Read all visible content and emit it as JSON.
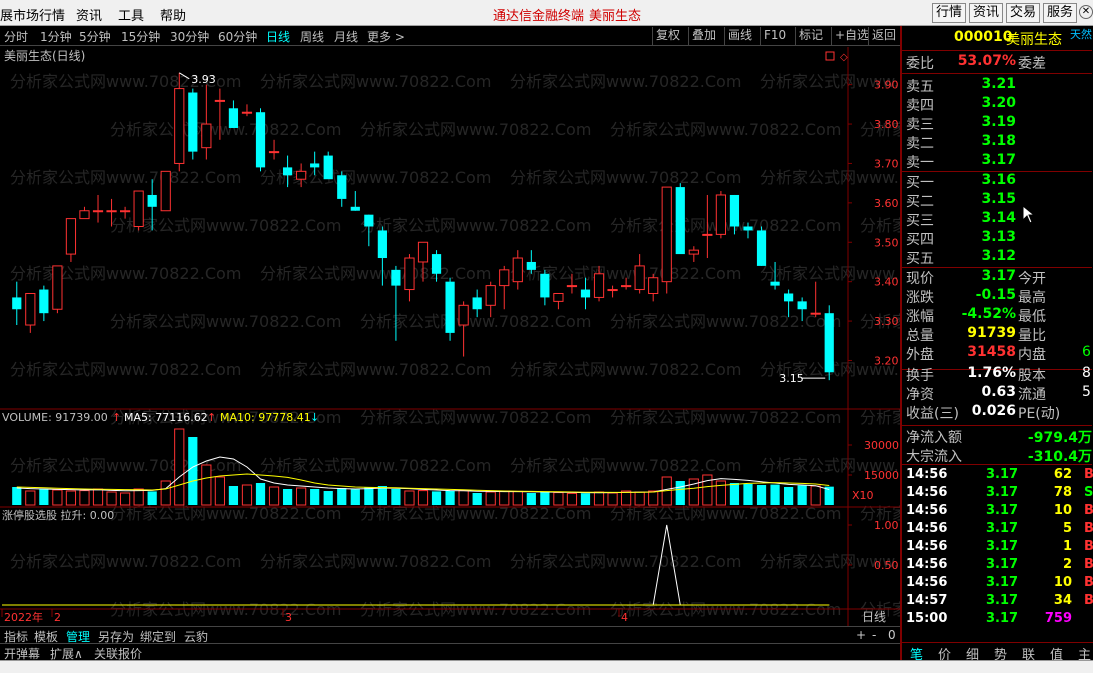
{
  "menubar": {
    "items": [
      "展市场行情",
      "资讯",
      "工具",
      "帮助"
    ],
    "center_title": "通达信金融终端",
    "center_stock": "美丽生态",
    "right_buttons": [
      "行情",
      "资讯",
      "交易",
      "服务"
    ]
  },
  "toolbar": {
    "periods": [
      "分时",
      "1分钟",
      "5分钟",
      "15分钟",
      "30分钟",
      "60分钟",
      "日线",
      "周线",
      "月线",
      "更多 >"
    ],
    "active_period": "日线",
    "buttons": [
      "复权",
      "叠加",
      "画线",
      "F10",
      "标记",
      "+自选",
      "返回"
    ]
  },
  "chart": {
    "title": "美丽生态(日线)",
    "high_label": "3.93",
    "low_label": "3.15",
    "volume_legend": {
      "volume": "VOLUME: 91739.00",
      "ma5": "MA5: 77116.62",
      "ma10": "MA10: 97778.41"
    },
    "indicator_legend": "涨停股选股  拉升: 0.00",
    "x_labels": [
      "2022年",
      "2",
      "3",
      "4"
    ],
    "period_label": "日线",
    "zoom_buttons": [
      "+",
      "-",
      "0"
    ],
    "multiplier": "X10",
    "watermark": "分析家公式网www.70822.Com",
    "colors": {
      "up": "#ff3232",
      "down": "#00ffff",
      "ma5": "#ffffff",
      "ma10": "#ffff00",
      "axis": "#800000"
    }
  },
  "chart_data": [
    {
      "type": "candlestick",
      "title": "美丽生态(日线)",
      "ylim": [
        3.12,
        3.96
      ],
      "yticks": [
        3.2,
        3.3,
        3.4,
        3.5,
        3.6,
        3.7,
        3.8,
        3.9
      ],
      "ohlc": [
        [
          3.36,
          3.4,
          3.29,
          3.33
        ],
        [
          3.29,
          3.37,
          3.27,
          3.37
        ],
        [
          3.38,
          3.39,
          3.3,
          3.32
        ],
        [
          3.33,
          3.44,
          3.32,
          3.44
        ],
        [
          3.47,
          3.56,
          3.45,
          3.56
        ],
        [
          3.56,
          3.59,
          3.57,
          3.58
        ],
        [
          3.58,
          3.62,
          3.55,
          3.58
        ],
        [
          3.58,
          3.61,
          3.54,
          3.58
        ],
        [
          3.58,
          3.59,
          3.56,
          3.58
        ],
        [
          3.54,
          3.63,
          3.53,
          3.63
        ],
        [
          3.62,
          3.66,
          3.53,
          3.59
        ],
        [
          3.58,
          3.68,
          3.58,
          3.68
        ],
        [
          3.7,
          3.93,
          3.68,
          3.89
        ],
        [
          3.88,
          3.89,
          3.71,
          3.73
        ],
        [
          3.74,
          3.9,
          3.71,
          3.8
        ],
        [
          3.86,
          3.89,
          3.76,
          3.86
        ],
        [
          3.84,
          3.86,
          3.79,
          3.79
        ],
        [
          3.83,
          3.85,
          3.82,
          3.83
        ],
        [
          3.83,
          3.84,
          3.68,
          3.69
        ],
        [
          3.73,
          3.76,
          3.71,
          3.73
        ],
        [
          3.69,
          3.72,
          3.64,
          3.67
        ],
        [
          3.66,
          3.7,
          3.64,
          3.68
        ],
        [
          3.7,
          3.73,
          3.67,
          3.69
        ],
        [
          3.72,
          3.73,
          3.67,
          3.66
        ],
        [
          3.67,
          3.68,
          3.59,
          3.61
        ],
        [
          3.59,
          3.63,
          3.58,
          3.58
        ],
        [
          3.57,
          3.57,
          3.49,
          3.54
        ],
        [
          3.53,
          3.54,
          3.39,
          3.46
        ],
        [
          3.43,
          3.44,
          3.25,
          3.39
        ],
        [
          3.38,
          3.47,
          3.35,
          3.46
        ],
        [
          3.45,
          3.49,
          3.4,
          3.5
        ],
        [
          3.47,
          3.48,
          3.4,
          3.42
        ],
        [
          3.4,
          3.41,
          3.25,
          3.27
        ],
        [
          3.29,
          3.35,
          3.21,
          3.34
        ],
        [
          3.36,
          3.38,
          3.31,
          3.33
        ],
        [
          3.34,
          3.4,
          3.31,
          3.39
        ],
        [
          3.39,
          3.44,
          3.33,
          3.43
        ],
        [
          3.4,
          3.48,
          3.38,
          3.46
        ],
        [
          3.45,
          3.48,
          3.42,
          3.43
        ],
        [
          3.42,
          3.43,
          3.34,
          3.36
        ],
        [
          3.35,
          3.37,
          3.33,
          3.37
        ],
        [
          3.39,
          3.42,
          3.37,
          3.39
        ],
        [
          3.38,
          3.41,
          3.33,
          3.36
        ],
        [
          3.36,
          3.44,
          3.35,
          3.42
        ],
        [
          3.38,
          3.39,
          3.36,
          3.38
        ],
        [
          3.39,
          3.41,
          3.38,
          3.39
        ],
        [
          3.38,
          3.47,
          3.37,
          3.44
        ],
        [
          3.37,
          3.42,
          3.35,
          3.41
        ],
        [
          3.4,
          3.63,
          3.37,
          3.64
        ],
        [
          3.64,
          3.65,
          3.48,
          3.47
        ],
        [
          3.47,
          3.49,
          3.45,
          3.48
        ],
        [
          3.52,
          3.62,
          3.46,
          3.52
        ],
        [
          3.52,
          3.63,
          3.51,
          3.62
        ],
        [
          3.62,
          3.62,
          3.52,
          3.54
        ],
        [
          3.54,
          3.55,
          3.51,
          3.53
        ],
        [
          3.53,
          3.54,
          3.44,
          3.44
        ],
        [
          3.4,
          3.45,
          3.38,
          3.39
        ],
        [
          3.37,
          3.38,
          3.31,
          3.35
        ],
        [
          3.35,
          3.36,
          3.3,
          3.33
        ],
        [
          3.32,
          3.4,
          3.31,
          3.32
        ],
        [
          3.32,
          3.34,
          3.15,
          3.17
        ]
      ],
      "price_labels": {
        "high": "3.93",
        "low": "3.15"
      }
    },
    {
      "type": "bar",
      "title": "VOLUME",
      "ylim": [
        0,
        40000
      ],
      "yticks": [
        15000,
        30000
      ],
      "unit_label": "X10",
      "values": [
        9000,
        7000,
        8000,
        7500,
        7000,
        7200,
        8000,
        6500,
        6000,
        8000,
        6800,
        12000,
        38000,
        34000,
        20000,
        14000,
        9500,
        10000,
        11000,
        9000,
        8000,
        8500,
        8000,
        7000,
        8500,
        7800,
        9000,
        9500,
        8000,
        7000,
        7200,
        6800,
        7000,
        7500,
        6000,
        6500,
        7000,
        6800,
        6000,
        6400,
        6200,
        5800,
        5900,
        6500,
        6000,
        7000,
        6500,
        7000,
        14000,
        12000,
        13000,
        15000,
        12000,
        11000,
        10500,
        10000,
        10200,
        9000,
        9800,
        9500,
        9174
      ],
      "ma5_values": [
        8500,
        8200,
        8000,
        7800,
        7700,
        7500,
        7600,
        7300,
        7100,
        7200,
        7300,
        8200,
        14000,
        19000,
        22000,
        24000,
        23000,
        19000,
        13000,
        11000,
        10000,
        9500,
        9000,
        8500,
        8200,
        8000,
        8200,
        8500,
        8400,
        8200,
        7800,
        7500,
        7200,
        7100,
        6900,
        6800,
        6700,
        6700,
        6600,
        6500,
        6400,
        6300,
        6200,
        6100,
        6200,
        6300,
        6400,
        6500,
        7800,
        9000,
        10500,
        12200,
        13200,
        12800,
        12300,
        11600,
        11000,
        10300,
        10000,
        9600,
        7712
      ],
      "ma10_values": [
        9000,
        8800,
        8600,
        8400,
        8200,
        8000,
        7900,
        7800,
        7700,
        7600,
        7500,
        8000,
        10000,
        12000,
        13500,
        14500,
        15000,
        15500,
        15000,
        14500,
        13800,
        12500,
        11000,
        10000,
        9500,
        9000,
        8800,
        8700,
        8600,
        8400,
        8200,
        8000,
        7800,
        7600,
        7400,
        7200,
        7000,
        6900,
        6800,
        6700,
        6600,
        6500,
        6400,
        6400,
        6300,
        6300,
        6400,
        6500,
        7200,
        7800,
        8400,
        9200,
        9800,
        10300,
        10800,
        11000,
        11200,
        11000,
        10800,
        10500,
        9778
      ]
    },
    {
      "type": "line",
      "title": "涨停股选股",
      "ylim": [
        0,
        1.1
      ],
      "yticks": [
        0.5,
        1.0
      ],
      "values": [
        0,
        0,
        0,
        0,
        0,
        0,
        0,
        0,
        0,
        0,
        0,
        0,
        0,
        0,
        0,
        0,
        0,
        0,
        0,
        0,
        0,
        0,
        0,
        0,
        0,
        0,
        0,
        0,
        0,
        0,
        0,
        0,
        0,
        0,
        0,
        0,
        0,
        0,
        0,
        0,
        0,
        0,
        0,
        0,
        0,
        0,
        0,
        0,
        1,
        0,
        0,
        0,
        0,
        0,
        0,
        0,
        0,
        0,
        0,
        0,
        0
      ]
    }
  ],
  "quote": {
    "code": "000010",
    "name": "美丽生态",
    "extra": "天然",
    "wei_bi_label": "委比",
    "wei_bi_value": "53.07%",
    "wei_cha_label": "委差",
    "asks": [
      {
        "label": "卖五",
        "price": "3.21"
      },
      {
        "label": "卖四",
        "price": "3.20"
      },
      {
        "label": "卖三",
        "price": "3.19"
      },
      {
        "label": "卖二",
        "price": "3.18"
      },
      {
        "label": "卖一",
        "price": "3.17"
      }
    ],
    "bids": [
      {
        "label": "买一",
        "price": "3.16"
      },
      {
        "label": "买二",
        "price": "3.15"
      },
      {
        "label": "买三",
        "price": "3.14"
      },
      {
        "label": "买四",
        "price": "3.13"
      },
      {
        "label": "买五",
        "price": "3.12"
      }
    ],
    "stats": [
      {
        "l1": "现价",
        "v1": "3.17",
        "c1": "#00ff00",
        "l2": "今开",
        "v2": ""
      },
      {
        "l1": "涨跌",
        "v1": "-0.15",
        "c1": "#00ff00",
        "l2": "最高",
        "v2": ""
      },
      {
        "l1": "涨幅",
        "v1": "-4.52%",
        "c1": "#00ff00",
        "l2": "最低",
        "v2": ""
      },
      {
        "l1": "总量",
        "v1": "91739",
        "c1": "#ffff00",
        "l2": "量比",
        "v2": ""
      },
      {
        "l1": "外盘",
        "v1": "31458",
        "c1": "#ff3232",
        "l2": "内盘",
        "v2": "6"
      }
    ],
    "stats2": [
      {
        "l1": "换手",
        "v1": "1.76%",
        "c1": "#ffffff",
        "l2": "股本",
        "v2": "8"
      },
      {
        "l1": "净资",
        "v1": "0.63",
        "c1": "#ffffff",
        "l2": "流通",
        "v2": "5"
      },
      {
        "l1": "收益(三)",
        "v1": "0.026",
        "c1": "#ffffff",
        "l2": "PE(动)",
        "v2": ""
      }
    ],
    "flows": [
      {
        "label": "净流入额",
        "value": "-979.4万"
      },
      {
        "label": "大宗流入",
        "value": "-310.4万"
      }
    ],
    "ticks": [
      {
        "time": "14:56",
        "price": "3.17",
        "vol": "62",
        "vc": "#ffff00",
        "bs": "B"
      },
      {
        "time": "14:56",
        "price": "3.17",
        "vol": "78",
        "vc": "#ffff00",
        "bs": "S"
      },
      {
        "time": "14:56",
        "price": "3.17",
        "vol": "10",
        "vc": "#ffff00",
        "bs": "B"
      },
      {
        "time": "14:56",
        "price": "3.17",
        "vol": "5",
        "vc": "#ffff00",
        "bs": "B"
      },
      {
        "time": "14:56",
        "price": "3.17",
        "vol": "1",
        "vc": "#ffff00",
        "bs": "B"
      },
      {
        "time": "14:56",
        "price": "3.17",
        "vol": "2",
        "vc": "#ffff00",
        "bs": "B"
      },
      {
        "time": "14:56",
        "price": "3.17",
        "vol": "10",
        "vc": "#ffff00",
        "bs": "B"
      },
      {
        "time": "14:57",
        "price": "3.17",
        "vol": "34",
        "vc": "#ffff00",
        "bs": "B"
      },
      {
        "time": "15:00",
        "price": "3.17",
        "vol": "759",
        "vc": "#ff00ff",
        "bs": ""
      }
    ],
    "bottom_tabs": [
      "笔",
      "价",
      "细",
      "势",
      "联",
      "值",
      "主"
    ]
  },
  "bottom": {
    "tabs1": [
      "指标",
      "模板",
      "管理",
      "另存为",
      "绑定到",
      "云豹"
    ],
    "tabs1_active": "管理",
    "tabs2": [
      "开弹幕",
      "扩展∧",
      "关联报价"
    ]
  }
}
